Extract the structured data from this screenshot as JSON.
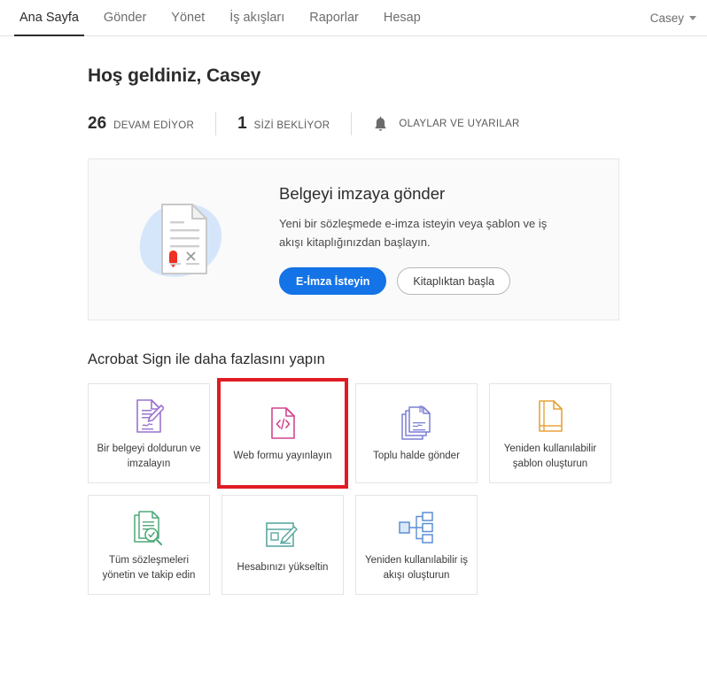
{
  "nav": {
    "items": [
      {
        "label": "Ana Sayfa",
        "active": true
      },
      {
        "label": "Gönder",
        "active": false
      },
      {
        "label": "Yönet",
        "active": false
      },
      {
        "label": "İş akışları",
        "active": false
      },
      {
        "label": "Raporlar",
        "active": false
      },
      {
        "label": "Hesap",
        "active": false
      }
    ],
    "user_menu_label": "Casey"
  },
  "page": {
    "welcome_title": "Hoş geldiniz, Casey"
  },
  "stats": {
    "in_progress": {
      "count": "26",
      "label": "DEVAM EDİYOR"
    },
    "waiting_for_you": {
      "count": "1",
      "label": "SİZİ BEKLİYOR"
    },
    "events_alerts": {
      "label": "OLAYLAR VE UYARILAR"
    }
  },
  "hero": {
    "title": "Belgeyi imzaya gönder",
    "description": "Yeni bir sözleşmede e-imza isteyin veya şablon ve iş akışı kitaplığınızdan başlayın.",
    "primary_button": "E-İmza İsteyin",
    "secondary_button": "Kitaplıktan başla"
  },
  "tiles_section": {
    "title": "Acrobat Sign ile daha fazlasını yapın",
    "tiles": [
      {
        "label": "Bir belgeyi doldurun ve imzalayın",
        "icon": "document-sign-icon",
        "color": "#9a74d0",
        "highlighted": false
      },
      {
        "label": "Web formu yayınlayın",
        "icon": "web-form-code-icon",
        "color": "#d1478f",
        "highlighted": true
      },
      {
        "label": "Toplu halde gönder",
        "icon": "bulk-send-icon",
        "color": "#7b7fd4",
        "highlighted": false
      },
      {
        "label": "Yeniden kullanılabilir şablon oluşturun",
        "icon": "template-document-icon",
        "color": "#e8a33d",
        "highlighted": false
      },
      {
        "label": "Tüm sözleşmeleri yönetin ve takip edin",
        "icon": "manage-track-search-icon",
        "color": "#4fa97a",
        "highlighted": false
      },
      {
        "label": "Hesabınızı yükseltin",
        "icon": "upgrade-account-icon",
        "color": "#5aa8a0",
        "highlighted": false
      },
      {
        "label": "Yeniden kullanılabilir iş akışı oluşturun",
        "icon": "workflow-diagram-icon",
        "color": "#5b8fd4",
        "highlighted": false
      }
    ]
  },
  "colors": {
    "accent_blue": "#1473e6",
    "highlight_red": "#e01b24",
    "text_primary": "#2c2c2c",
    "text_muted": "#6e6e6e",
    "card_bg": "#fafafa"
  }
}
